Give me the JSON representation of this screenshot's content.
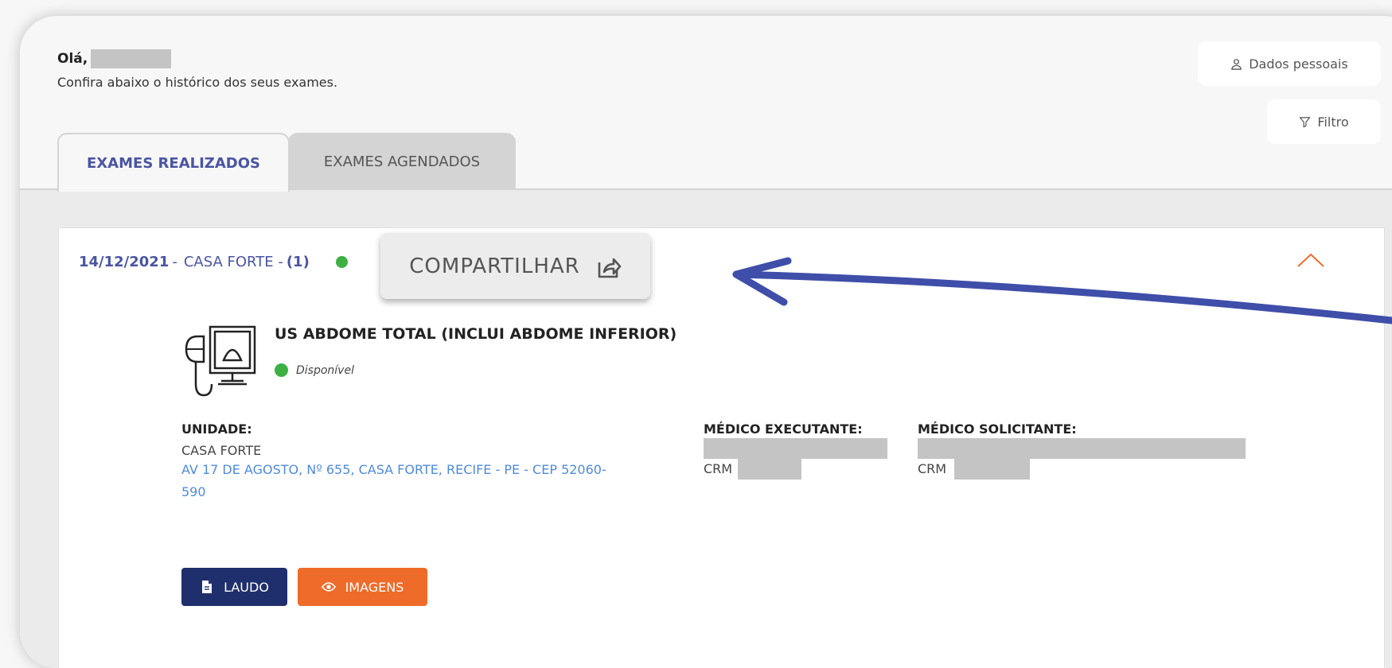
{
  "greeting": {
    "hello": "Olá,",
    "subtitle": "Confira abaixo o histórico dos seus exames."
  },
  "actions": {
    "personal_data": "Dados pessoais",
    "filter": "Filtro"
  },
  "tabs": [
    {
      "label": "EXAMES REALIZADOS",
      "active": true
    },
    {
      "label": "EXAMES AGENDADOS",
      "active": false
    }
  ],
  "exam_card": {
    "date": "14/12/2021",
    "separator": "-",
    "location": "CASA FORTE -",
    "count": "(1)",
    "status_color": "#3cb043",
    "share_label": "COMPARTILHAR",
    "exam_title": "US ABDOME TOTAL (INCLUI ABDOME INFERIOR)",
    "exam_status": "Disponível",
    "unit_label": "UNIDADE:",
    "unit_name": "CASA FORTE",
    "unit_address": "AV 17 DE AGOSTO, Nº 655, CASA FORTE, RECIFE - PE - CEP 52060-590",
    "executing_doctor_label": "MÉDICO EXECUTANTE:",
    "requesting_doctor_label": "MÉDICO SOLICITANTE:",
    "crm_label": "CRM",
    "report_button": "LAUDO",
    "images_button": "IMAGENS"
  },
  "colors": {
    "primary": "#1f2f6d",
    "accent": "#ef6b2a",
    "link": "#4e8bdc",
    "tab_active": "#4a55a2",
    "annotation_arrow": "#3f4ea8"
  }
}
